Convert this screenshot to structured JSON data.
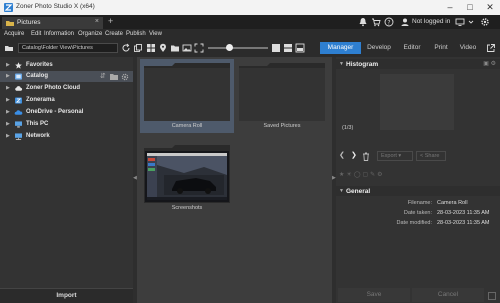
{
  "window": {
    "title": "Zoner Photo Studio X (x64)",
    "minimize": "–",
    "maximize": "□",
    "close": "✕"
  },
  "tabs": {
    "active_label": "Pictures",
    "close": "×",
    "new": "+",
    "login_label": "Not logged in"
  },
  "menu": [
    "Acquire",
    "Edit",
    "Information",
    "Organize",
    "Create",
    "Publish",
    "View"
  ],
  "toolbar": {
    "path": "Catalog\\Folder View\\Pictures"
  },
  "modes": [
    "Manager",
    "Develop",
    "Editor",
    "Print",
    "Video"
  ],
  "active_mode": "Manager",
  "tree": [
    {
      "label": "Favorites",
      "icon": "star-icon"
    },
    {
      "label": "Catalog",
      "icon": "catalog-icon"
    },
    {
      "label": "Zoner Photo Cloud",
      "icon": "cloud-icon"
    },
    {
      "label": "Zonerama",
      "icon": "zonerama-icon"
    },
    {
      "label": "OneDrive - Personal",
      "icon": "onedrive-icon"
    },
    {
      "label": "This PC",
      "icon": "computer-icon"
    },
    {
      "label": "Network",
      "icon": "network-icon"
    }
  ],
  "import_label": "Import",
  "thumbnails": [
    {
      "label": "Camera Roll"
    },
    {
      "label": "Saved Pictures"
    },
    {
      "label": "Screenshots"
    }
  ],
  "histogram": {
    "title": "Histogram",
    "counter": "(1/3)"
  },
  "actions": {
    "export": "Export",
    "share": "Share"
  },
  "general": {
    "title": "General",
    "rows": [
      {
        "key": "Filename:",
        "value": "Camera Roll"
      },
      {
        "key": "Date taken:",
        "value": "28-03-2023 11:35 AM"
      },
      {
        "key": "Date modified:",
        "value": "28-03-2023 11:35 AM"
      }
    ]
  },
  "bottom": {
    "save": "Save",
    "cancel": "Cancel"
  },
  "colors": {
    "accent": "#2e7fd1",
    "panel": "#333333",
    "selection": "#4a4f57"
  }
}
